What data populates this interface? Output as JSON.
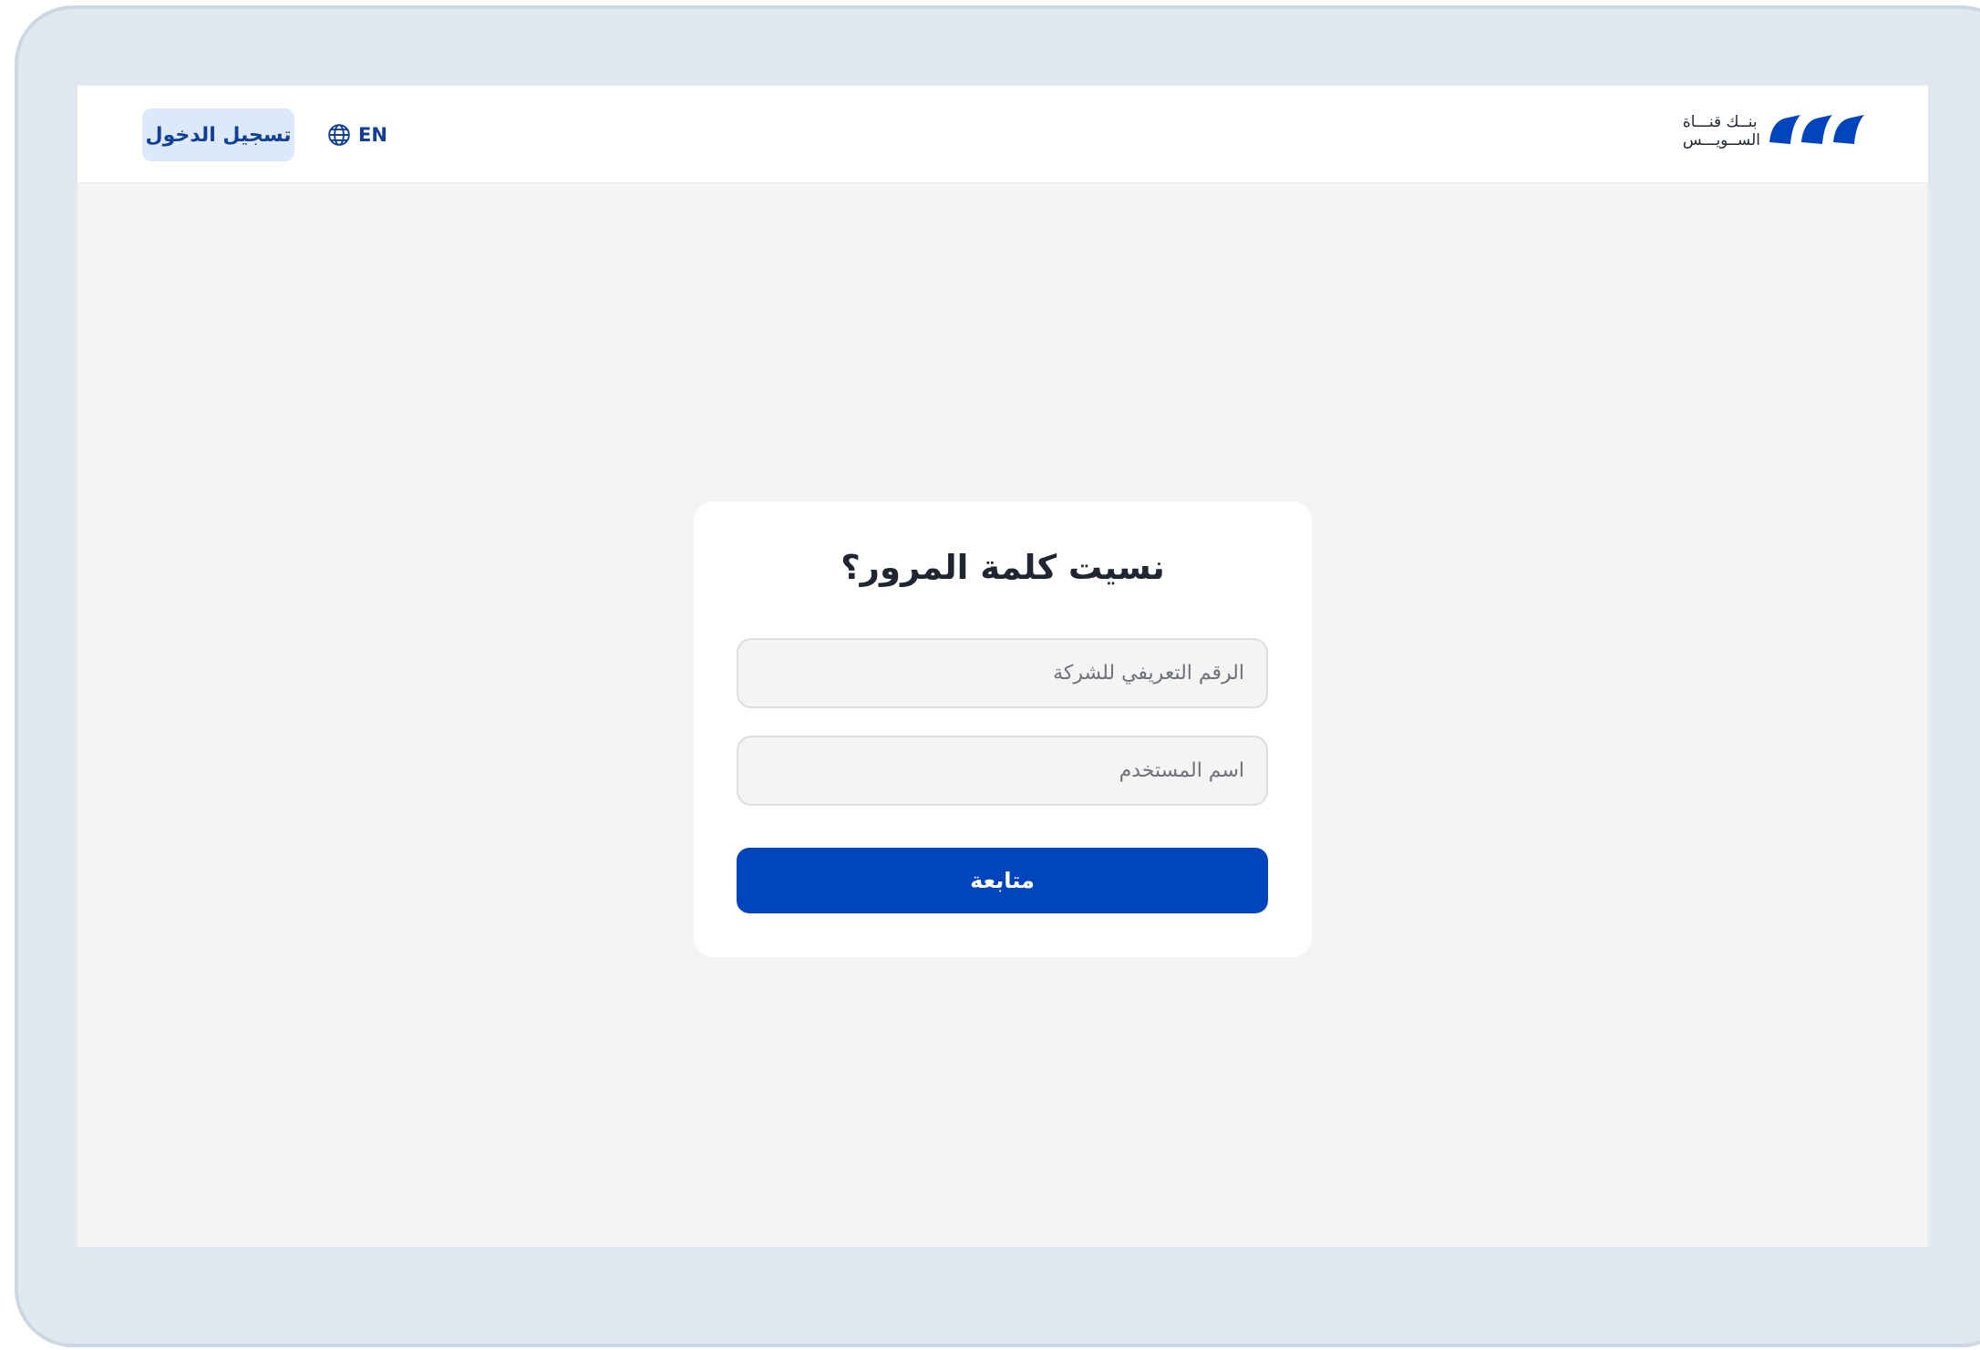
{
  "header": {
    "login_label": "تسجيل الدخول",
    "language_label": "EN",
    "brand": {
      "line1": "بنــك قنـــاة",
      "line2": "الســويـــس",
      "color": "#0044bd"
    }
  },
  "form": {
    "title": "نسيت كلمة المرور؟",
    "company_id_placeholder": "الرقم التعريفي للشركة",
    "username_placeholder": "اسم المستخدم",
    "continue_label": "متابعة"
  },
  "colors": {
    "primary": "#0044bd",
    "primary_light": "#dde8fb",
    "frame": "#e1e8f0",
    "page_background": "#f4f4f4"
  }
}
